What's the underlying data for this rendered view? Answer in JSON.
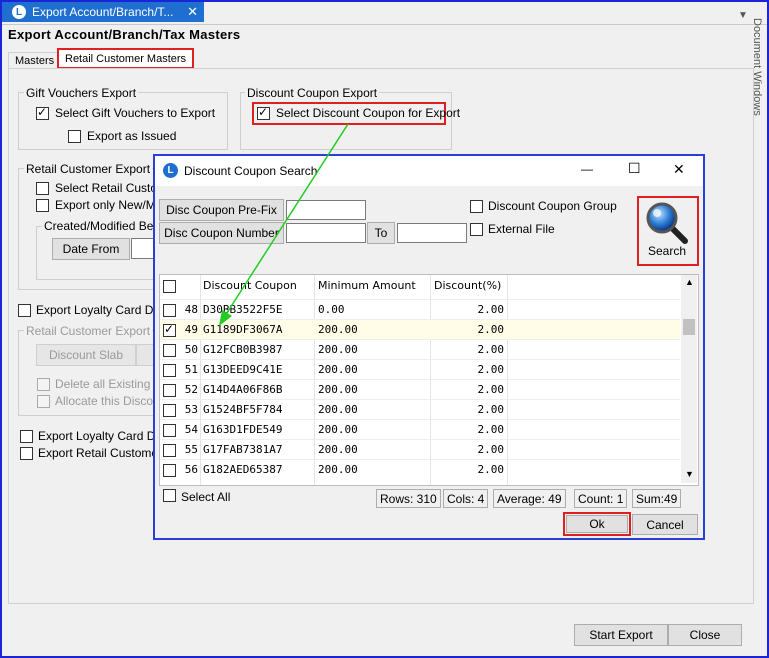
{
  "window": {
    "tab_title": "Export Account/Branch/T...",
    "tab_close": "✕",
    "logo_letter": "L",
    "title": "Export Account/Branch/Tax Masters",
    "side_panel": "Document Windows",
    "chevron": "▼",
    "pin": "☒"
  },
  "tabs": {
    "masters": "Masters",
    "retail": "Retail Customer Masters"
  },
  "gift": {
    "group": "Gift Vouchers Export",
    "select": "Select Gift Vouchers to Export",
    "issued": "Export as Issued"
  },
  "coupon": {
    "group": "Discount Coupon Export",
    "select": "Select Discount Coupon for Export"
  },
  "retail_export": {
    "group": "Retail Customer Export",
    "select": "Select Retail Custom",
    "only_new": "Export only New/Mod",
    "created_group": "Created/Modified Betw",
    "date_from": "Date From"
  },
  "loyalty": {
    "export": "Export Loyalty Card Disco",
    "retail_group": "Retail Customer Export",
    "discount_slab": "Discount Slab",
    "delete_all": "Delete all Existing Sla",
    "allocate": "Allocate this Discoun",
    "export2": "Export Loyalty Card Disc",
    "export_retail": "Export Retail Customer +"
  },
  "footer": {
    "start": "Start Export",
    "close": "Close"
  },
  "dialog": {
    "title": "Discount Coupon Search",
    "minimize": "—",
    "maximize": "☐",
    "close": "✕",
    "prefix_label": "Disc Coupon Pre-Fix",
    "number_label": "Disc Coupon Number",
    "to_label": "To",
    "group_cb": "Discount Coupon Group",
    "external_cb": "External File",
    "search": "Search",
    "columns": [
      "Discount Coupon",
      "Minimum Amount",
      "Discount(%)"
    ],
    "rows": [
      {
        "n": "48",
        "code": "D30BB3522F5E",
        "min": "0.00",
        "disc": "2.00"
      },
      {
        "n": "49",
        "code": "G1189DF3067A",
        "min": "200.00",
        "disc": "2.00"
      },
      {
        "n": "50",
        "code": "G12FCB0B3987",
        "min": "200.00",
        "disc": "2.00"
      },
      {
        "n": "51",
        "code": "G13DEED9C41E",
        "min": "200.00",
        "disc": "2.00"
      },
      {
        "n": "52",
        "code": "G14D4A06F86B",
        "min": "200.00",
        "disc": "2.00"
      },
      {
        "n": "53",
        "code": "G1524BF5F784",
        "min": "200.00",
        "disc": "2.00"
      },
      {
        "n": "54",
        "code": "G163D1FDE549",
        "min": "200.00",
        "disc": "2.00"
      },
      {
        "n": "55",
        "code": "G17FAB7381A7",
        "min": "200.00",
        "disc": "2.00"
      },
      {
        "n": "56",
        "code": "G182AED65387",
        "min": "200.00",
        "disc": "2.00"
      }
    ],
    "select_all": "Select All",
    "status": {
      "rows": "Rows: 310",
      "cols": "Cols: 4",
      "avg": "Average: 49",
      "count": "Count: 1",
      "sum": "Sum:49"
    },
    "ok": "Ok",
    "cancel": "Cancel"
  },
  "colors": {
    "accent": "#1e6fd0",
    "highlight": "#e02020",
    "arrow": "#22cc22"
  }
}
